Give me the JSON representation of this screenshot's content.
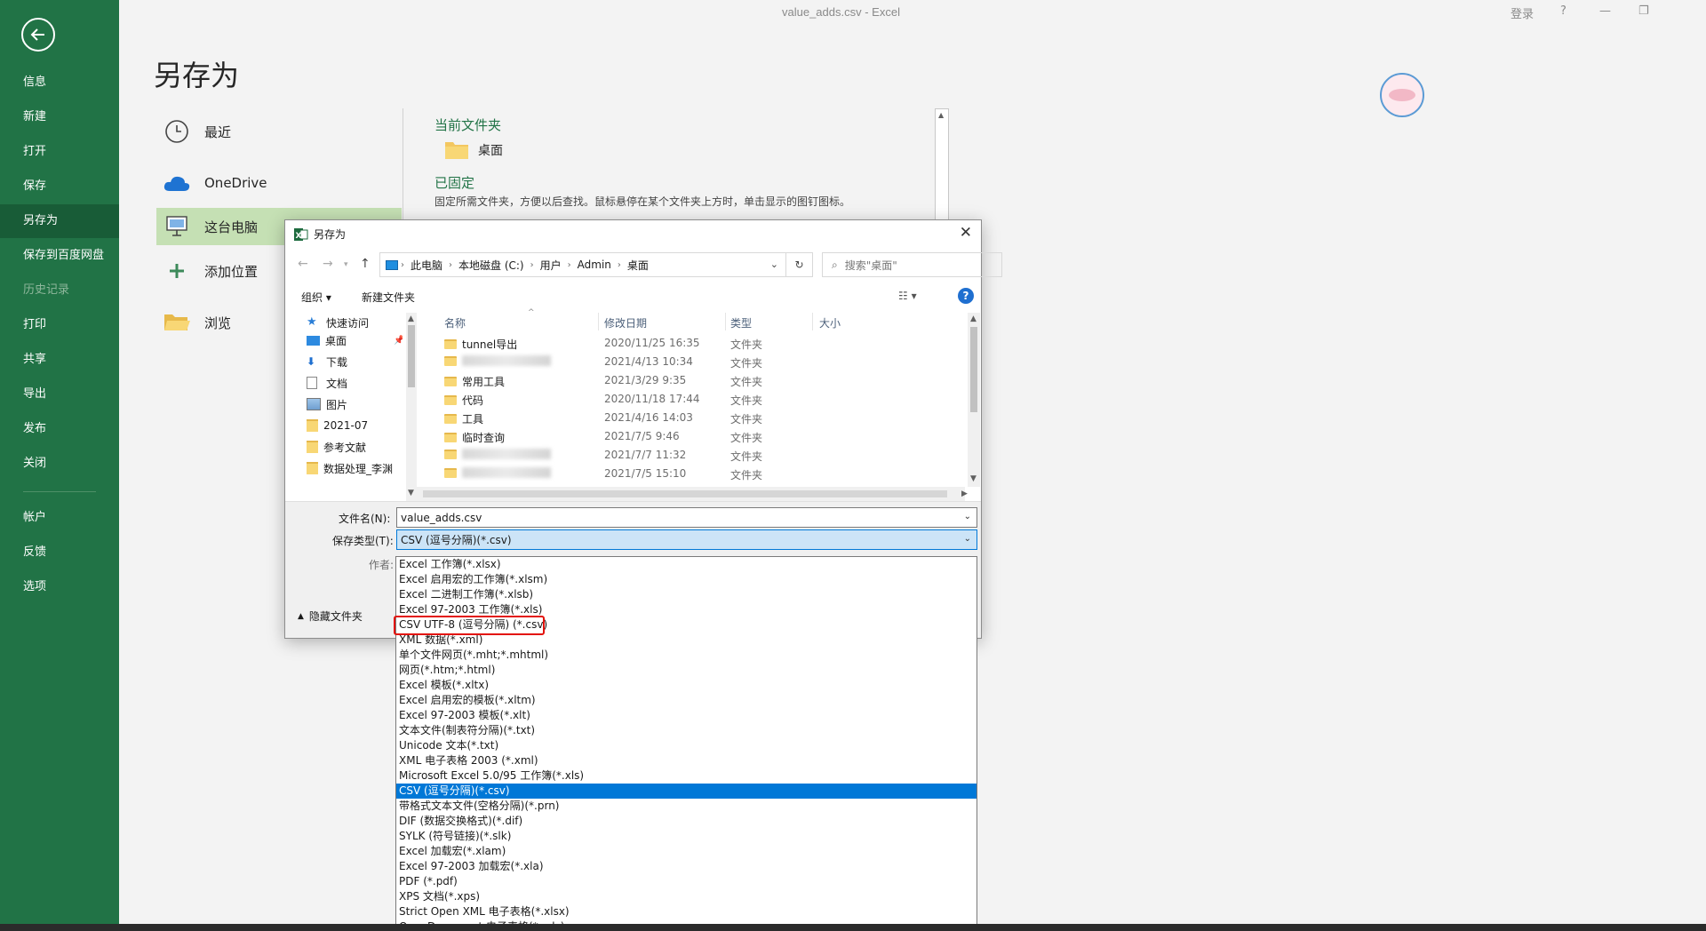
{
  "window": {
    "title": "value_adds.csv  -  Excel",
    "login": "登录",
    "help": "?",
    "minimize": "—",
    "restore": "❐"
  },
  "sidebar": {
    "items": [
      {
        "label": "信息"
      },
      {
        "label": "新建"
      },
      {
        "label": "打开"
      },
      {
        "label": "保存"
      },
      {
        "label": "另存为"
      },
      {
        "label": "保存到百度网盘"
      },
      {
        "label": "历史记录"
      },
      {
        "label": "打印"
      },
      {
        "label": "共享"
      },
      {
        "label": "导出"
      },
      {
        "label": "发布"
      },
      {
        "label": "关闭"
      },
      {
        "label": "帐户"
      },
      {
        "label": "反馈"
      },
      {
        "label": "选项"
      }
    ]
  },
  "saveas": {
    "title": "另存为",
    "locations": [
      {
        "label": "最近",
        "icon": "clock-icon"
      },
      {
        "label": "OneDrive",
        "icon": "cloud-icon"
      },
      {
        "label": "这台电脑",
        "icon": "computer-icon"
      },
      {
        "label": "添加位置",
        "icon": "plus-icon"
      },
      {
        "label": "浏览",
        "icon": "folder-open-icon"
      }
    ],
    "current_folder_title": "当前文件夹",
    "current_folder": "桌面",
    "pinned_title": "已固定",
    "pinned_desc": "固定所需文件夹，方便以后查找。鼠标悬停在某个文件夹上方时，单击显示的图钉图标。"
  },
  "dialog": {
    "title": "另存为",
    "address": [
      "此电脑",
      "本地磁盘 (C:)",
      "用户",
      "Admin",
      "桌面"
    ],
    "search_placeholder": "搜索\"桌面\"",
    "organize": "组织 ▾",
    "new_folder": "新建文件夹",
    "help": "?",
    "tree": [
      {
        "label": "快速访问",
        "icon": "star-icon"
      },
      {
        "label": "桌面",
        "icon": "desktop-icon",
        "pinned": true
      },
      {
        "label": "下载",
        "icon": "download-icon",
        "pinned": true
      },
      {
        "label": "文档",
        "icon": "document-icon",
        "pinned": true
      },
      {
        "label": "图片",
        "icon": "picture-icon",
        "pinned": true
      },
      {
        "label": "2021-07",
        "icon": "folder-icon"
      },
      {
        "label": "参考文献",
        "icon": "folder-icon"
      },
      {
        "label": "数据处理_李渊",
        "icon": "folder-icon"
      }
    ],
    "columns": {
      "name": "名称",
      "date": "修改日期",
      "type": "类型",
      "size": "大小"
    },
    "files": [
      {
        "name": "tunnel导出",
        "date": "2020/11/25 16:35",
        "type": "文件夹",
        "blurred": false
      },
      {
        "name": "",
        "date": "2021/4/13 10:34",
        "type": "文件夹",
        "blurred": true
      },
      {
        "name": "常用工具",
        "date": "2021/3/29 9:35",
        "type": "文件夹",
        "blurred": false
      },
      {
        "name": "代码",
        "date": "2020/11/18 17:44",
        "type": "文件夹",
        "blurred": false
      },
      {
        "name": "工具",
        "date": "2021/4/16 14:03",
        "type": "文件夹",
        "blurred": false
      },
      {
        "name": "临时查询",
        "date": "2021/7/5 9:46",
        "type": "文件夹",
        "blurred": false
      },
      {
        "name": "",
        "date": "2021/7/7 11:32",
        "type": "文件夹",
        "blurred": true
      },
      {
        "name": "",
        "date": "2021/7/5 15:10",
        "type": "文件夹",
        "blurred": true
      }
    ],
    "filename_label": "文件名(N):",
    "filename_value": "value_adds.csv",
    "filetype_label": "保存类型(T):",
    "filetype_value": "CSV (逗号分隔)(*.csv)",
    "author_label": "作者:",
    "hide_folders": "隐藏文件夹",
    "close": "✕"
  },
  "type_options": [
    "Excel 工作簿(*.xlsx)",
    "Excel 启用宏的工作簿(*.xlsm)",
    "Excel 二进制工作簿(*.xlsb)",
    "Excel 97-2003 工作簿(*.xls)",
    "CSV UTF-8 (逗号分隔) (*.csv)",
    "XML 数据(*.xml)",
    "单个文件网页(*.mht;*.mhtml)",
    "网页(*.htm;*.html)",
    "Excel 模板(*.xltx)",
    "Excel 启用宏的模板(*.xltm)",
    "Excel 97-2003 模板(*.xlt)",
    "文本文件(制表符分隔)(*.txt)",
    "Unicode 文本(*.txt)",
    "XML 电子表格 2003 (*.xml)",
    "Microsoft Excel 5.0/95 工作簿(*.xls)",
    "CSV (逗号分隔)(*.csv)",
    "带格式文本文件(空格分隔)(*.prn)",
    "DIF (数据交换格式)(*.dif)",
    "SYLK (符号链接)(*.slk)",
    "Excel 加载宏(*.xlam)",
    "Excel 97-2003 加载宏(*.xla)",
    "PDF (*.pdf)",
    "XPS 文档(*.xps)",
    "Strict Open XML 电子表格(*.xlsx)",
    "OpenDocument 电子表格(*.ods)"
  ],
  "type_selected_index": 15,
  "type_highlighted_index": 4,
  "colors": {
    "excel_green": "#217346",
    "excel_green_dark": "#185c37",
    "selection_blue": "#0078d7",
    "highlight_red": "#e3120b"
  }
}
